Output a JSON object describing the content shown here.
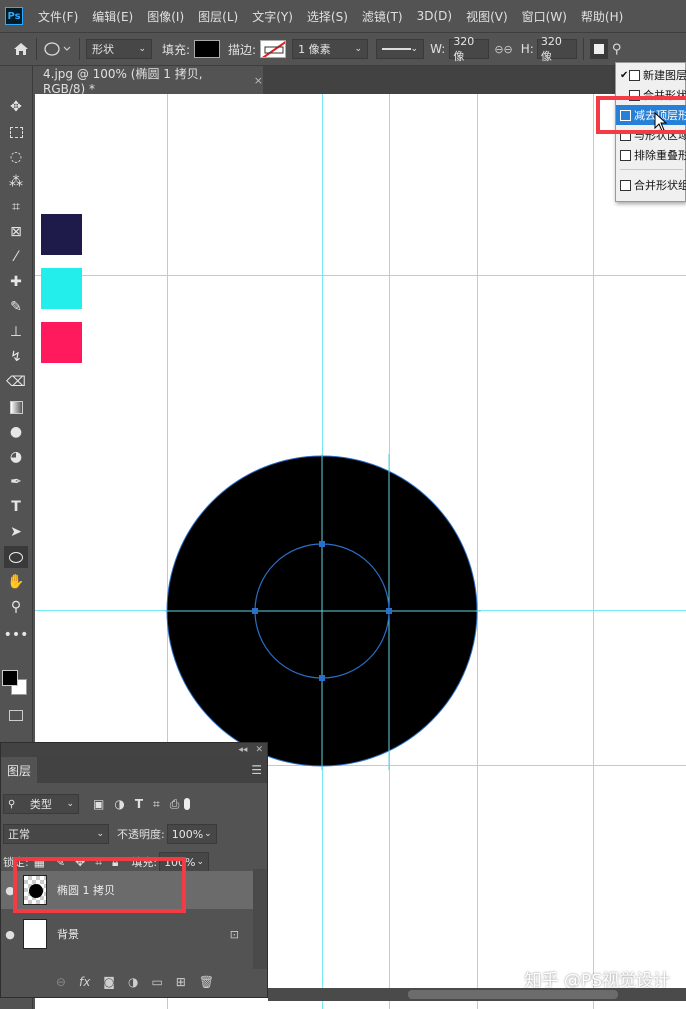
{
  "app": {
    "logo": "Ps"
  },
  "menubar": {
    "items": [
      "文件(F)",
      "编辑(E)",
      "图像(I)",
      "图层(L)",
      "文字(Y)",
      "选择(S)",
      "滤镜(T)",
      "3D(D)",
      "视图(V)",
      "窗口(W)",
      "帮助(H)"
    ]
  },
  "options": {
    "mode_value": "形状",
    "fill_label": "填充:",
    "stroke_label": "描边:",
    "stroke_width": "1 像素",
    "w_label": "W:",
    "w_value": "320 像",
    "h_label": "H:",
    "h_value": "320 像",
    "fill_color": "#000000"
  },
  "document": {
    "tab_title": "4.jpg @ 100% (椭圆 1 拷贝, RGB/8) *",
    "close": "×"
  },
  "canvas": {
    "swatches": [
      "#1e1a4a",
      "#23eeec",
      "#fe1a5d"
    ],
    "guide_color": "#78e9f0",
    "shape_color": "#000000",
    "path_color": "#2a6fc9"
  },
  "dropdown": {
    "items": [
      {
        "label": "新建图层",
        "checked": true,
        "selected": false
      },
      {
        "label": "合并形状",
        "checked": false,
        "selected": false
      },
      {
        "label": "减去顶层形状",
        "checked": false,
        "selected": true
      },
      {
        "label": "与形状区域相交",
        "checked": false,
        "selected": false
      },
      {
        "label": "排除重叠形状",
        "checked": false,
        "selected": false
      },
      {
        "label": "合并形状组件",
        "checked": false,
        "selected": false
      }
    ],
    "check_mark": "✔"
  },
  "layers_panel": {
    "tab_label": "图层",
    "filter_label": "类型",
    "blend_mode": "正常",
    "opacity_label": "不透明度:",
    "opacity_value": "100%",
    "lock_label": "锁定:",
    "fill_label": "填充:",
    "fill_value": "100%",
    "layers": [
      {
        "name": "椭圆 1 拷贝",
        "selected": true
      },
      {
        "name": "背景",
        "selected": false
      }
    ]
  },
  "watermark": "知乎 @PS视觉设计",
  "highlight_color": "#f23b45"
}
